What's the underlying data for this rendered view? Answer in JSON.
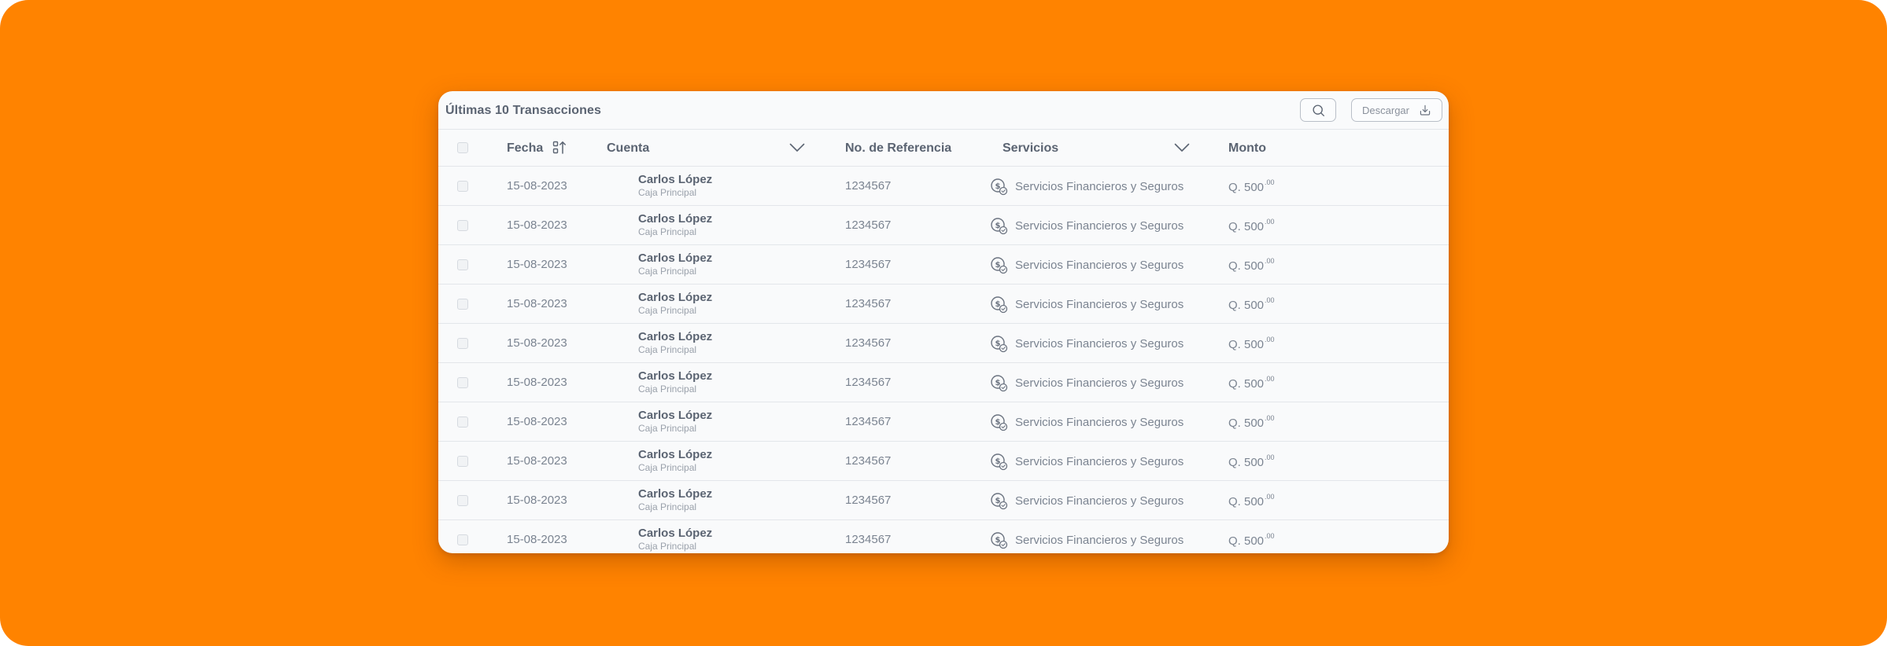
{
  "title": "Últimas 10 Transacciones",
  "toolbar": {
    "search_icon": "search-icon",
    "download_label": "Descargar",
    "download_icon": "download-icon"
  },
  "columns": {
    "fecha": "Fecha",
    "cuenta": "Cuenta",
    "referencia": "No. de Referencia",
    "servicios": "Servicios",
    "monto": "Monto"
  },
  "colors": {
    "background": "#FF8300",
    "card": "#F9FAFB",
    "text": "#5B6472"
  },
  "rows": [
    {
      "fecha": "15-08-2023",
      "cuenta": "Carlos López",
      "sub": "Caja Principal",
      "referencia": "1234567",
      "servicio": "Servicios Financieros y Seguros",
      "monto": "Q. 500",
      "cents": ".00"
    },
    {
      "fecha": "15-08-2023",
      "cuenta": "Carlos López",
      "sub": "Caja Principal",
      "referencia": "1234567",
      "servicio": "Servicios Financieros y Seguros",
      "monto": "Q. 500",
      "cents": ".00"
    },
    {
      "fecha": "15-08-2023",
      "cuenta": "Carlos López",
      "sub": "Caja Principal",
      "referencia": "1234567",
      "servicio": "Servicios Financieros y Seguros",
      "monto": "Q. 500",
      "cents": ".00"
    },
    {
      "fecha": "15-08-2023",
      "cuenta": "Carlos López",
      "sub": "Caja Principal",
      "referencia": "1234567",
      "servicio": "Servicios Financieros y Seguros",
      "monto": "Q. 500",
      "cents": ".00"
    },
    {
      "fecha": "15-08-2023",
      "cuenta": "Carlos López",
      "sub": "Caja Principal",
      "referencia": "1234567",
      "servicio": "Servicios Financieros y Seguros",
      "monto": "Q. 500",
      "cents": ".00"
    },
    {
      "fecha": "15-08-2023",
      "cuenta": "Carlos López",
      "sub": "Caja Principal",
      "referencia": "1234567",
      "servicio": "Servicios Financieros y Seguros",
      "monto": "Q. 500",
      "cents": ".00"
    },
    {
      "fecha": "15-08-2023",
      "cuenta": "Carlos López",
      "sub": "Caja Principal",
      "referencia": "1234567",
      "servicio": "Servicios Financieros y Seguros",
      "monto": "Q. 500",
      "cents": ".00"
    },
    {
      "fecha": "15-08-2023",
      "cuenta": "Carlos López",
      "sub": "Caja Principal",
      "referencia": "1234567",
      "servicio": "Servicios Financieros y Seguros",
      "monto": "Q. 500",
      "cents": ".00"
    },
    {
      "fecha": "15-08-2023",
      "cuenta": "Carlos López",
      "sub": "Caja Principal",
      "referencia": "1234567",
      "servicio": "Servicios Financieros y Seguros",
      "monto": "Q. 500",
      "cents": ".00"
    },
    {
      "fecha": "15-08-2023",
      "cuenta": "Carlos López",
      "sub": "Caja Principal",
      "referencia": "1234567",
      "servicio": "Servicios Financieros y Seguros",
      "monto": "Q. 500",
      "cents": ".00"
    }
  ]
}
